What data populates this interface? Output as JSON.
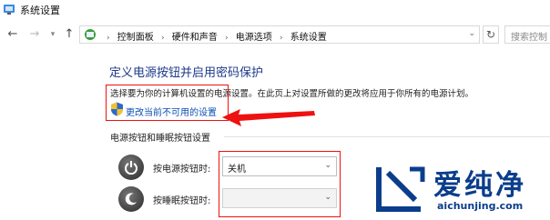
{
  "window": {
    "title": "系统设置"
  },
  "address_bar": {
    "crumbs": [
      "控制面板",
      "硬件和声音",
      "电源选项",
      "系统设置"
    ],
    "search_placeholder": "搜索控制"
  },
  "main": {
    "heading": "定义电源按钮并启用密码保护",
    "description": "选择要为你的计算机设置的电源设置。在此页上对设置所做的更改将应用于你所有的电源计划。",
    "change_link": "更改当前不可用的设置",
    "section_title": "电源按钮和睡眠按钮设置",
    "rows": [
      {
        "label": "按电源按钮时:",
        "value": "关机"
      },
      {
        "label": "按睡眠按钮时:",
        "value": ""
      }
    ]
  },
  "watermark": {
    "text": "爱纯净",
    "url": "aichunjing.com"
  },
  "colors": {
    "annotation": "#e11",
    "link": "#0a4fb5",
    "heading": "#1e3a8a"
  }
}
